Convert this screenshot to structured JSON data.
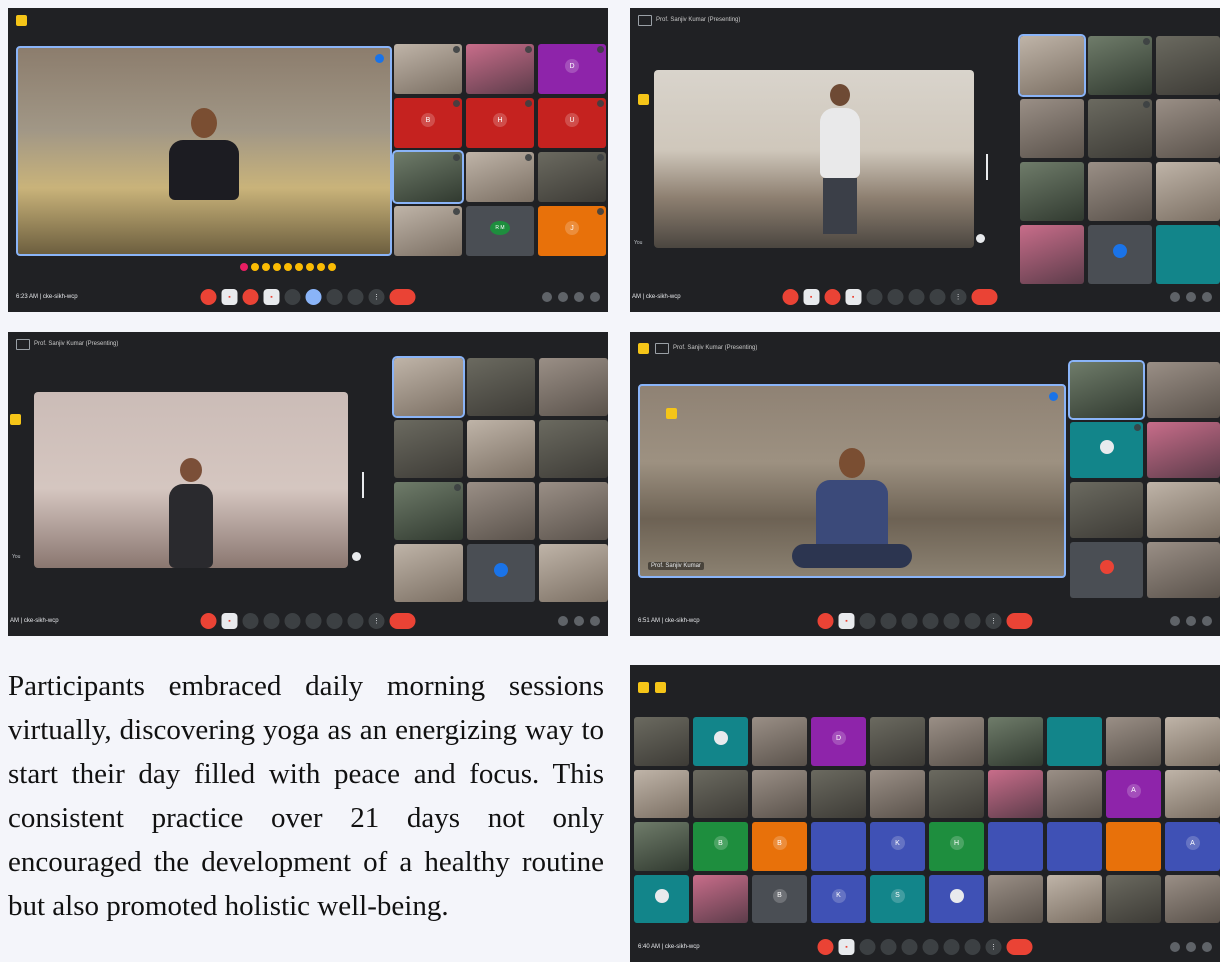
{
  "screenshot1": {
    "meeting_time": "6:23 AM | cke-sikh-wcp",
    "tiles": [
      {
        "kind": "video"
      },
      {
        "kind": "video"
      },
      {
        "kind": "avatar",
        "letter": "D",
        "color": "purple"
      },
      {
        "kind": "avatar",
        "letter": "B",
        "color": "red"
      },
      {
        "kind": "avatar",
        "letter": "H",
        "color": "red"
      },
      {
        "kind": "avatar",
        "letter": "U",
        "color": "red"
      },
      {
        "kind": "video"
      },
      {
        "kind": "video"
      },
      {
        "kind": "video"
      },
      {
        "kind": "video"
      },
      {
        "kind": "avatar",
        "letter": "R M",
        "color": "green"
      },
      {
        "kind": "avatar",
        "letter": "J",
        "color": "orange"
      }
    ]
  },
  "screenshot2": {
    "title": "Prof. Sanjiv Kumar (Presenting)",
    "meeting_time": "AM | cke-sikh-wcp",
    "you_label": "You"
  },
  "screenshot3": {
    "title": "Prof. Sanjiv Kumar (Presenting)",
    "meeting_time": "AM | cke-sikh-wcp",
    "you_label": "You"
  },
  "screenshot4": {
    "title": "Prof. Sanjiv Kumar (Presenting)",
    "meeting_time": "6:51 AM | cke-sikh-wcp",
    "stage_name": "Prof. Sanjiv Kumar"
  },
  "screenshot5": {
    "meeting_time": "6:40 AM | cke-sikh-wcp",
    "avatar_letters": [
      "D",
      "A",
      "B",
      "B",
      "K",
      "H",
      "A",
      "B",
      "K",
      "S"
    ]
  },
  "caption": "Participants embraced daily morning sessions virtually, discovering yoga as an energizing way to start their day filled with peace and focus. This consistent practice over 21 days not only encouraged the development of a healthy routine but also promoted holistic well-being.",
  "colors": {
    "meet_bg": "#202124",
    "hangup": "#ea4335",
    "accent_blue": "#8ab4f8",
    "page_bg": "#f4f5fa"
  }
}
